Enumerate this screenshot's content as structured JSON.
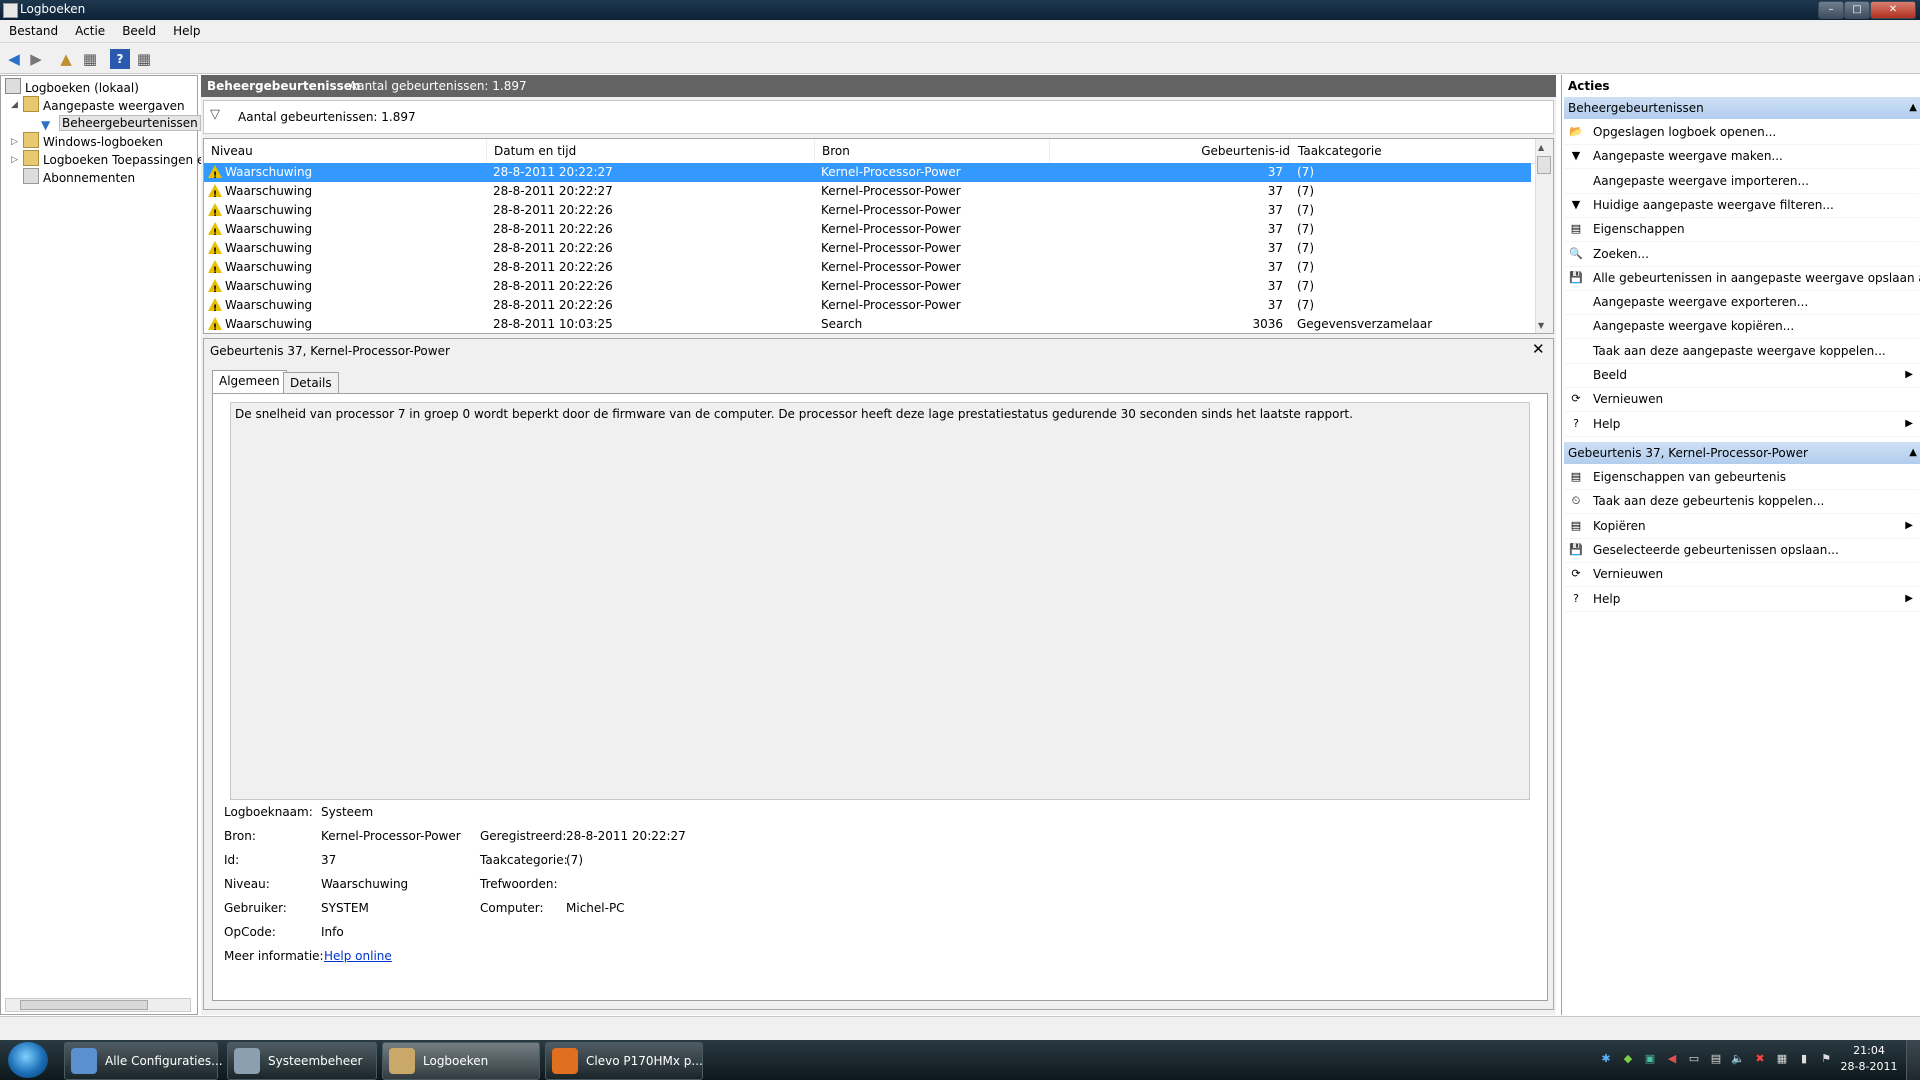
{
  "window": {
    "title": "Logboeken"
  },
  "menu": [
    "Bestand",
    "Actie",
    "Beeld",
    "Help"
  ],
  "toolbar": [
    {
      "name": "back-icon",
      "glyph": "◀"
    },
    {
      "name": "forward-icon",
      "glyph": "▶"
    },
    {
      "name": "up-folder-icon",
      "glyph": "▲"
    },
    {
      "name": "show-hide-tree-icon",
      "glyph": "▦"
    },
    {
      "name": "help-icon",
      "glyph": "?"
    },
    {
      "name": "show-hide-actions-icon",
      "glyph": "▦"
    }
  ],
  "tree": {
    "root": "Logboeken (lokaal)",
    "custom_views": "Aangepaste weergaven",
    "admin_events": "Beheergebeurtenissen",
    "windows_logs": "Windows-logboeken",
    "app_logs": "Logboeken Toepassingen en",
    "subscriptions": "Abonnementen"
  },
  "header": {
    "title": "Beheergebeurtenissen",
    "count": "Aantal gebeurtenissen: 1.897"
  },
  "filter": {
    "count": "Aantal gebeurtenissen: 1.897"
  },
  "table": {
    "columns": {
      "level": "Niveau",
      "datetime": "Datum en tijd",
      "source": "Bron",
      "event_id": "Gebeurtenis-id",
      "category": "Taakcategorie"
    },
    "rows": [
      {
        "level": "Waarschuwing",
        "datetime": "28-8-2011 20:22:27",
        "source": "Kernel-Processor-Power",
        "event_id": "37",
        "category": "(7)"
      },
      {
        "level": "Waarschuwing",
        "datetime": "28-8-2011 20:22:27",
        "source": "Kernel-Processor-Power",
        "event_id": "37",
        "category": "(7)"
      },
      {
        "level": "Waarschuwing",
        "datetime": "28-8-2011 20:22:26",
        "source": "Kernel-Processor-Power",
        "event_id": "37",
        "category": "(7)"
      },
      {
        "level": "Waarschuwing",
        "datetime": "28-8-2011 20:22:26",
        "source": "Kernel-Processor-Power",
        "event_id": "37",
        "category": "(7)"
      },
      {
        "level": "Waarschuwing",
        "datetime": "28-8-2011 20:22:26",
        "source": "Kernel-Processor-Power",
        "event_id": "37",
        "category": "(7)"
      },
      {
        "level": "Waarschuwing",
        "datetime": "28-8-2011 20:22:26",
        "source": "Kernel-Processor-Power",
        "event_id": "37",
        "category": "(7)"
      },
      {
        "level": "Waarschuwing",
        "datetime": "28-8-2011 20:22:26",
        "source": "Kernel-Processor-Power",
        "event_id": "37",
        "category": "(7)"
      },
      {
        "level": "Waarschuwing",
        "datetime": "28-8-2011 20:22:26",
        "source": "Kernel-Processor-Power",
        "event_id": "37",
        "category": "(7)"
      },
      {
        "level": "Waarschuwing",
        "datetime": "28-8-2011 10:03:25",
        "source": "Search",
        "event_id": "3036",
        "category": "Gegevensverzamelaar"
      }
    ]
  },
  "detail": {
    "title": "Gebeurtenis 37, Kernel-Processor-Power",
    "tabs": [
      "Algemeen",
      "Details"
    ],
    "description": "De snelheid van processor 7 in groep 0 wordt beperkt door de firmware van de computer. De processor heeft deze lage prestatiestatus gedurende 30 seconden sinds het laatste rapport.",
    "fields": {
      "log_name_label": "Logboeknaam:",
      "log_name": "Systeem",
      "source_label": "Bron:",
      "source": "Kernel-Processor-Power",
      "logged_label": "Geregistreerd:",
      "logged": "28-8-2011 20:22:27",
      "id_label": "Id:",
      "id": "37",
      "category_label": "Taakcategorie:",
      "category": "(7)",
      "level_label": "Niveau:",
      "level": "Waarschuwing",
      "keywords_label": "Trefwoorden:",
      "keywords": "",
      "user_label": "Gebruiker:",
      "user": "SYSTEM",
      "computer_label": "Computer:",
      "computer": "Michel-PC",
      "opcode_label": "OpCode:",
      "opcode": "Info",
      "more_info_label": "Meer informatie:",
      "more_info": "Help online"
    }
  },
  "actions": {
    "title": "Acties",
    "section1": "Beheergebeurtenissen",
    "items1": [
      {
        "icon": "open-log-icon",
        "glyph": "📂",
        "label": "Opgeslagen logboek openen...",
        "submenu": false
      },
      {
        "icon": "create-view-icon",
        "glyph": "▼",
        "label": "Aangepaste weergave maken...",
        "submenu": false
      },
      {
        "icon": "",
        "glyph": "",
        "label": "Aangepaste weergave importeren...",
        "submenu": false
      },
      {
        "icon": "filter-icon",
        "glyph": "▼",
        "label": "Huidige aangepaste weergave filteren...",
        "submenu": false
      },
      {
        "icon": "properties-icon",
        "glyph": "▤",
        "label": "Eigenschappen",
        "submenu": false
      },
      {
        "icon": "find-icon",
        "glyph": "🔍",
        "label": "Zoeken...",
        "submenu": false
      },
      {
        "icon": "save-icon",
        "glyph": "💾",
        "label": "Alle gebeurtenissen in aangepaste weergave opslaan al...",
        "submenu": false
      },
      {
        "icon": "",
        "glyph": "",
        "label": "Aangepaste weergave exporteren...",
        "submenu": false
      },
      {
        "icon": "",
        "glyph": "",
        "label": "Aangepaste weergave kopiëren...",
        "submenu": false
      },
      {
        "icon": "",
        "glyph": "",
        "label": "Taak aan deze aangepaste weergave koppelen...",
        "submenu": false
      },
      {
        "icon": "",
        "glyph": "",
        "label": "Beeld",
        "submenu": true
      },
      {
        "icon": "refresh-icon",
        "glyph": "⟳",
        "label": "Vernieuwen",
        "submenu": false
      },
      {
        "icon": "help-icon",
        "glyph": "?",
        "label": "Help",
        "submenu": true
      }
    ],
    "section2": "Gebeurtenis 37, Kernel-Processor-Power",
    "items2": [
      {
        "icon": "event-properties-icon",
        "glyph": "▤",
        "label": "Eigenschappen van gebeurtenis",
        "submenu": false
      },
      {
        "icon": "attach-task-icon",
        "glyph": "⏲",
        "label": "Taak aan deze gebeurtenis koppelen...",
        "submenu": false
      },
      {
        "icon": "copy-icon",
        "glyph": "▤",
        "label": "Kopiëren",
        "submenu": true
      },
      {
        "icon": "save-icon",
        "glyph": "💾",
        "label": "Geselecteerde gebeurtenissen opslaan...",
        "submenu": false
      },
      {
        "icon": "refresh-icon",
        "glyph": "⟳",
        "label": "Vernieuwen",
        "submenu": false
      },
      {
        "icon": "help-icon",
        "glyph": "?",
        "label": "Help",
        "submenu": true
      }
    ]
  },
  "taskbar": {
    "tasks": [
      {
        "label": "Alle Configuraties...",
        "color": "#5a8fd0",
        "active": false
      },
      {
        "label": "Systeembeheer",
        "color": "#8aa0b0",
        "active": false
      },
      {
        "label": "Logboeken",
        "color": "#c9a86a",
        "active": true
      },
      {
        "label": "Clevo P170HMx p...",
        "color": "#e07020",
        "active": false
      }
    ],
    "clock": {
      "time": "21:04",
      "date": "28-8-2011"
    }
  },
  "colors": {
    "selection": "#3399ff",
    "warning": "#e8c000",
    "header_bar": "#636363",
    "action_section": "#b2cdee"
  }
}
